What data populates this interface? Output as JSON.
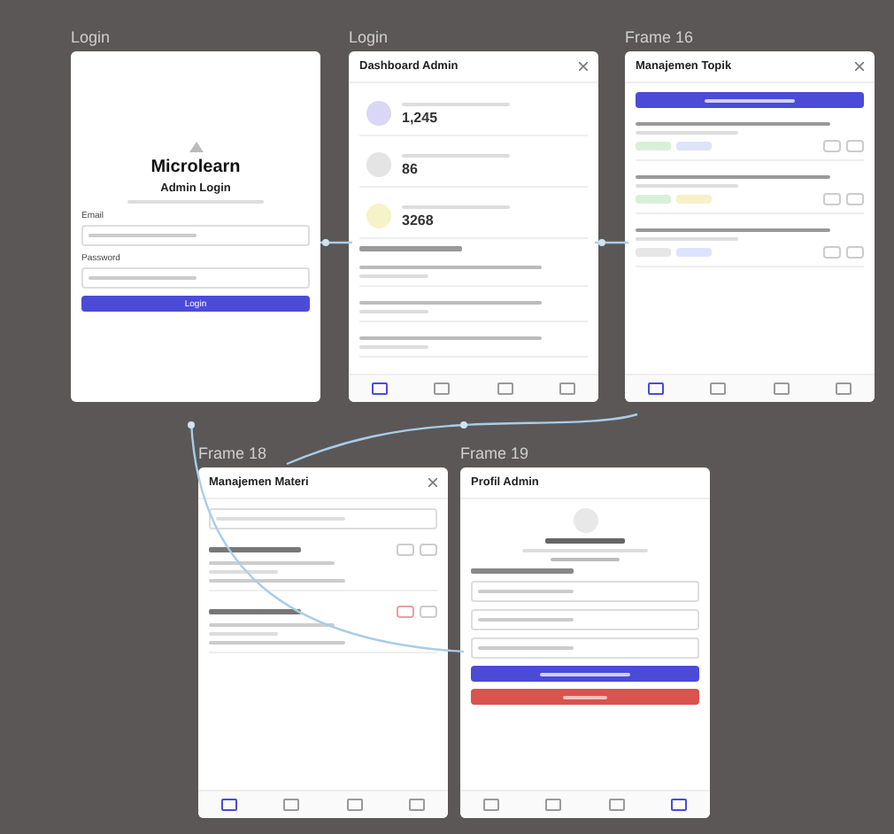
{
  "frames": [
    {
      "label": "Login",
      "kind": "login",
      "brand": "Microlearn",
      "title": "Admin Login",
      "fields": [
        {
          "label": "Email"
        },
        {
          "label": "Password"
        }
      ],
      "button": "Login"
    },
    {
      "label": "Login",
      "kind": "dashboard",
      "header": "Dashboard Admin",
      "stats": [
        {
          "value": "1,245",
          "color": "#d9d6f7"
        },
        {
          "value": "86",
          "color": "#e4e4e4"
        },
        {
          "value": "3268",
          "color": "#f6f3c8"
        }
      ],
      "activities": [
        {
          "kind": "row"
        },
        {
          "kind": "row"
        },
        {
          "kind": "row"
        }
      ],
      "nav": [
        {
          "selected": true
        },
        {
          "selected": false
        },
        {
          "selected": false
        },
        {
          "selected": false
        }
      ]
    },
    {
      "label": "Frame 16",
      "kind": "topics",
      "header": "Manajemen Topik",
      "items": [
        {
          "tags": [
            {
              "color": "#d8f0d8"
            },
            {
              "color": "#dde3fa"
            }
          ]
        },
        {
          "tags": [
            {
              "color": "#d8f0d8"
            },
            {
              "color": "#f7f1c8"
            }
          ]
        },
        {
          "tags": [
            {
              "color": "#e6e6e6"
            },
            {
              "color": "#dde3fa"
            }
          ]
        }
      ],
      "nav": [
        {
          "selected": true
        },
        {
          "selected": false
        },
        {
          "selected": false
        },
        {
          "selected": false
        }
      ]
    },
    {
      "label": "Frame 18",
      "kind": "materials",
      "header": "Manajemen Materi",
      "items": [
        {
          "danger": false
        },
        {
          "danger": true
        }
      ],
      "nav": [
        {
          "selected": true
        },
        {
          "selected": false
        },
        {
          "selected": false
        },
        {
          "selected": false
        }
      ]
    },
    {
      "label": "Frame 19",
      "kind": "profile",
      "header": "Profil Admin",
      "inputs": [
        {
          "kind": "input"
        },
        {
          "kind": "input"
        },
        {
          "kind": "input"
        }
      ],
      "nav": [
        {
          "selected": false
        },
        {
          "selected": false
        },
        {
          "selected": false
        },
        {
          "selected": true
        }
      ]
    }
  ]
}
